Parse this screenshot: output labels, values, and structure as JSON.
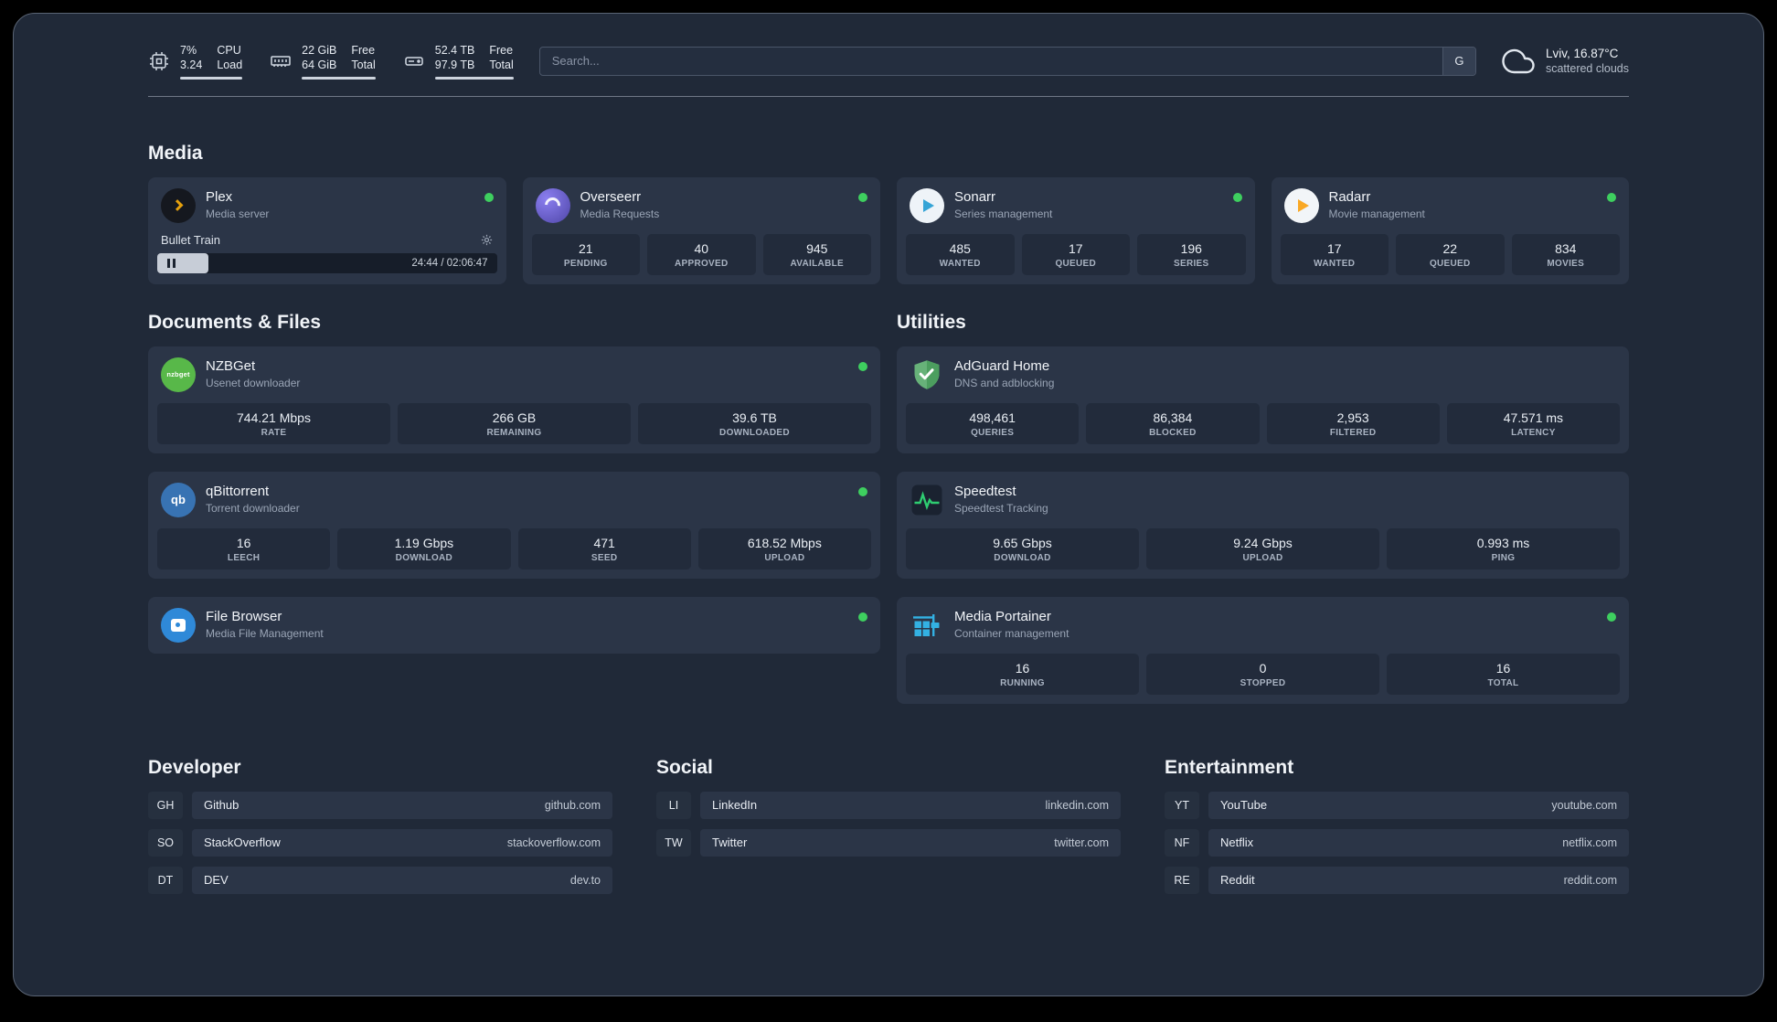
{
  "colors": {
    "status_online": "#3ecf5f",
    "plex_amber": "#e5a00d",
    "adguard_green": "#67b279",
    "speedtest_green": "#2ecc71",
    "portainer_blue": "#33b1e3"
  },
  "topbar": {
    "cpu": {
      "value1": "7%",
      "value2": "3.24",
      "label1": "CPU",
      "label2": "Load"
    },
    "ram": {
      "value1": "22 GiB",
      "value2": "64 GiB",
      "label1": "Free",
      "label2": "Total"
    },
    "disk": {
      "value1": "52.4 TB",
      "value2": "97.9 TB",
      "label1": "Free",
      "label2": "Total"
    },
    "search": {
      "placeholder": "Search...",
      "engine_button": "G"
    },
    "weather": {
      "location": "Lviv, 16.87°C",
      "condition": "scattered clouds"
    }
  },
  "media": {
    "heading": "Media",
    "plex": {
      "title": "Plex",
      "subtitle": "Media server",
      "now_playing": "Bullet Train",
      "time": "24:44 / 02:06:47"
    },
    "overseerr": {
      "title": "Overseerr",
      "subtitle": "Media Requests",
      "stats": [
        {
          "value": "21",
          "label": "PENDING"
        },
        {
          "value": "40",
          "label": "APPROVED"
        },
        {
          "value": "945",
          "label": "AVAILABLE"
        }
      ]
    },
    "sonarr": {
      "title": "Sonarr",
      "subtitle": "Series management",
      "stats": [
        {
          "value": "485",
          "label": "WANTED"
        },
        {
          "value": "17",
          "label": "QUEUED"
        },
        {
          "value": "196",
          "label": "SERIES"
        }
      ]
    },
    "radarr": {
      "title": "Radarr",
      "subtitle": "Movie management",
      "stats": [
        {
          "value": "17",
          "label": "WANTED"
        },
        {
          "value": "22",
          "label": "QUEUED"
        },
        {
          "value": "834",
          "label": "MOVIES"
        }
      ]
    }
  },
  "documents": {
    "heading": "Documents & Files",
    "nzbget": {
      "title": "NZBGet",
      "subtitle": "Usenet downloader",
      "icon_text": "nzbget",
      "stats": [
        {
          "value": "744.21 Mbps",
          "label": "RATE"
        },
        {
          "value": "266 GB",
          "label": "REMAINING"
        },
        {
          "value": "39.6 TB",
          "label": "DOWNLOADED"
        }
      ]
    },
    "qbittorrent": {
      "title": "qBittorrent",
      "subtitle": "Torrent downloader",
      "icon_text": "qb",
      "stats": [
        {
          "value": "16",
          "label": "LEECH"
        },
        {
          "value": "1.19 Gbps",
          "label": "DOWNLOAD"
        },
        {
          "value": "471",
          "label": "SEED"
        },
        {
          "value": "618.52 Mbps",
          "label": "UPLOAD"
        }
      ]
    },
    "filebrowser": {
      "title": "File Browser",
      "subtitle": "Media File Management"
    }
  },
  "utilities": {
    "heading": "Utilities",
    "adguard": {
      "title": "AdGuard Home",
      "subtitle": "DNS and adblocking",
      "stats": [
        {
          "value": "498,461",
          "label": "QUERIES"
        },
        {
          "value": "86,384",
          "label": "BLOCKED"
        },
        {
          "value": "2,953",
          "label": "FILTERED"
        },
        {
          "value": "47.571 ms",
          "label": "LATENCY"
        }
      ]
    },
    "speedtest": {
      "title": "Speedtest",
      "subtitle": "Speedtest Tracking",
      "stats": [
        {
          "value": "9.65 Gbps",
          "label": "DOWNLOAD"
        },
        {
          "value": "9.24 Gbps",
          "label": "UPLOAD"
        },
        {
          "value": "0.993 ms",
          "label": "PING"
        }
      ]
    },
    "portainer": {
      "title": "Media Portainer",
      "subtitle": "Container management",
      "stats": [
        {
          "value": "16",
          "label": "RUNNING"
        },
        {
          "value": "0",
          "label": "STOPPED"
        },
        {
          "value": "16",
          "label": "TOTAL"
        }
      ]
    }
  },
  "bookmarks": {
    "developer": {
      "heading": "Developer",
      "items": [
        {
          "abbr": "GH",
          "name": "Github",
          "url": "github.com"
        },
        {
          "abbr": "SO",
          "name": "StackOverflow",
          "url": "stackoverflow.com"
        },
        {
          "abbr": "DT",
          "name": "DEV",
          "url": "dev.to"
        }
      ]
    },
    "social": {
      "heading": "Social",
      "items": [
        {
          "abbr": "LI",
          "name": "LinkedIn",
          "url": "linkedin.com"
        },
        {
          "abbr": "TW",
          "name": "Twitter",
          "url": "twitter.com"
        }
      ]
    },
    "entertainment": {
      "heading": "Entertainment",
      "items": [
        {
          "abbr": "YT",
          "name": "YouTube",
          "url": "youtube.com"
        },
        {
          "abbr": "NF",
          "name": "Netflix",
          "url": "netflix.com"
        },
        {
          "abbr": "RE",
          "name": "Reddit",
          "url": "reddit.com"
        }
      ]
    }
  }
}
